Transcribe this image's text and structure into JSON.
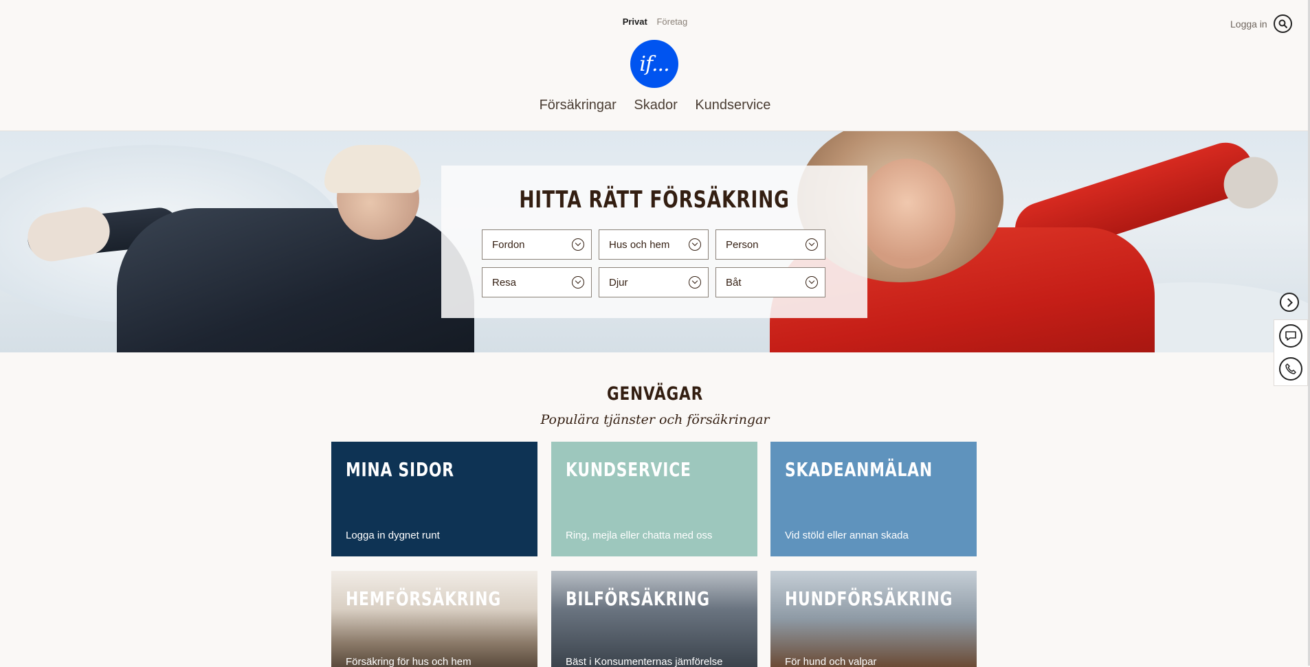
{
  "header": {
    "segment": {
      "active": "Privat",
      "inactive": "Företag"
    },
    "logo_text": "if...",
    "nav": [
      "Försäkringar",
      "Skador",
      "Kundservice"
    ],
    "login": "Logga in"
  },
  "hero": {
    "title": "HITTA RÄTT FÖRSÄKRING",
    "dropdowns": [
      "Fordon",
      "Hus och hem",
      "Person",
      "Resa",
      "Djur",
      "Båt"
    ]
  },
  "shortcuts": {
    "title": "GENVÄGAR",
    "subtitle": "Populära tjänster och försäkringar",
    "cards": [
      {
        "title": "MINA SIDOR",
        "desc": "Logga in dygnet runt"
      },
      {
        "title": "KUNDSERVICE",
        "desc": "Ring, mejla eller chatta med oss"
      },
      {
        "title": "SKADEANMÄLAN",
        "desc": "Vid stöld eller annan skada"
      },
      {
        "title": "HEMFÖRSÄKRING",
        "desc": "Försäkring för hus och hem"
      },
      {
        "title": "BILFÖRSÄKRING",
        "desc": "Bäst i Konsumenternas jämförelse"
      },
      {
        "title": "HUNDFÖRSÄKRING",
        "desc": "För hund och valpar"
      }
    ]
  },
  "icons": [
    "search-icon",
    "chevron-down-icon",
    "chevron-right-icon",
    "chat-icon",
    "phone-icon"
  ],
  "colors": {
    "brand_blue": "#0054f0",
    "text_brown": "#331e11",
    "card_navy": "#0e3354",
    "card_mint": "#9dc7bd",
    "card_blue": "#5f93bd"
  }
}
